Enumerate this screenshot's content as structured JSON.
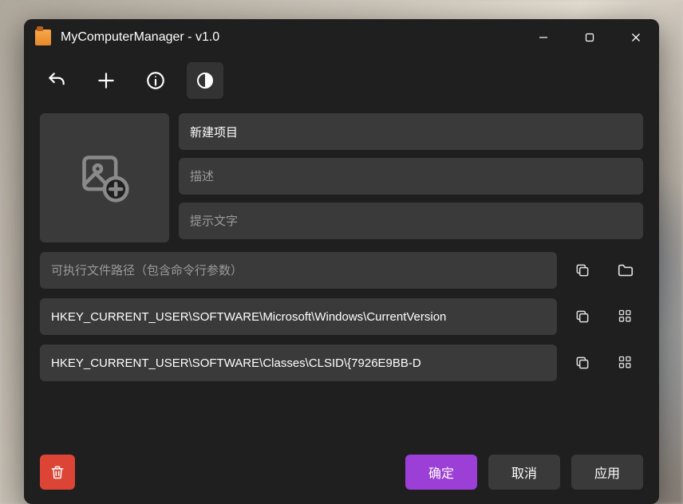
{
  "window": {
    "title": "MyComputerManager - v1.0"
  },
  "toolbar": {
    "undo": "undo",
    "add": "add",
    "info": "info",
    "theme": "toggle-theme"
  },
  "form": {
    "name": {
      "value": "新建项目",
      "placeholder": ""
    },
    "description": {
      "value": "",
      "placeholder": "描述"
    },
    "tooltip": {
      "value": "",
      "placeholder": "提示文字"
    },
    "exe": {
      "value": "",
      "placeholder": "可执行文件路径（包含命令行参数）"
    },
    "reg1": {
      "value": "HKEY_CURRENT_USER\\SOFTWARE\\Microsoft\\Windows\\CurrentVersion"
    },
    "reg2": {
      "value": "HKEY_CURRENT_USER\\SOFTWARE\\Classes\\CLSID\\{7926E9BB-D"
    }
  },
  "buttons": {
    "ok": "确定",
    "cancel": "取消",
    "apply": "应用"
  },
  "icons": {
    "copy": "copy",
    "browse": "browse-folder",
    "regedit": "regedit"
  },
  "colors": {
    "accent": "#9b3fd6",
    "danger": "#dc4535",
    "bg": "#1f1f1f",
    "field": "#3a3a3a"
  }
}
